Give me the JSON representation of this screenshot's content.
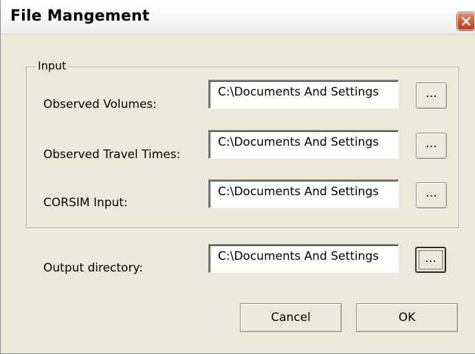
{
  "window": {
    "title": "File Mangement",
    "close_label": "×"
  },
  "input_group": {
    "legend": "Input",
    "rows": [
      {
        "label": "Observed Volumes:",
        "value": "C:\\Documents And Settings",
        "browse_label": "..."
      },
      {
        "label": "Observed Travel Times:",
        "value": "C:\\Documents And Settings",
        "browse_label": "..."
      },
      {
        "label": "CORSIM Input:",
        "value": "C:\\Documents And Settings",
        "browse_label": "..."
      }
    ]
  },
  "output": {
    "label": "Output directory:",
    "value": "C:\\Documents And Settings",
    "browse_label": "..."
  },
  "buttons": {
    "cancel": "Cancel",
    "ok": "OK"
  },
  "icons": {
    "close": "close-icon"
  },
  "colors": {
    "dialog_bg": "#ece9d8",
    "close_button": "#d9593b"
  }
}
